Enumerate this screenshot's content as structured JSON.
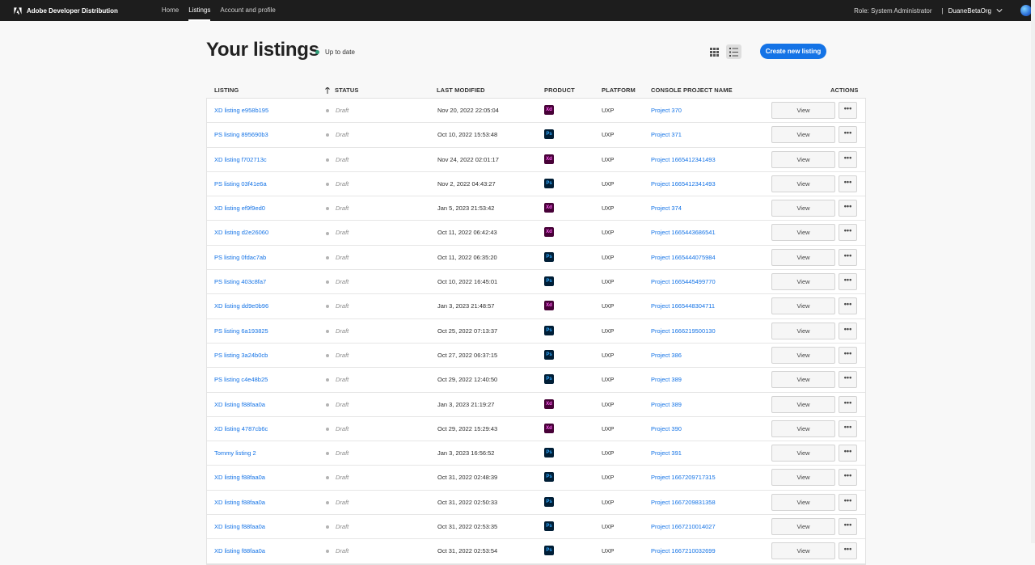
{
  "topbar": {
    "brand": "Adobe Developer Distribution",
    "nav": [
      {
        "label": "Home",
        "active": false
      },
      {
        "label": "Listings",
        "active": true
      },
      {
        "label": "Account and profile",
        "active": false
      }
    ],
    "role": "Role: System Administrator",
    "separator": "|",
    "org": "DuaneBetaOrg"
  },
  "header": {
    "title": "Your listings",
    "status": "Up to date",
    "create_button": "Create new listing"
  },
  "table": {
    "columns": {
      "listing": "LISTING",
      "status": "STATUS",
      "last_modified": "LAST MODIFIED",
      "product": "PRODUCT",
      "platform": "PLATFORM",
      "project": "CONSOLE PROJECT NAME",
      "actions": "ACTIONS"
    },
    "view_label": "View",
    "more_label": "•••",
    "rows": [
      {
        "listing": "XD listing e958b195",
        "status": "Draft",
        "modified": "Nov 20, 2022 22:05:04",
        "product": "Xd",
        "platform": "UXP",
        "project": "Project 370"
      },
      {
        "listing": "PS listing 895690b3",
        "status": "Draft",
        "modified": "Oct 10, 2022 15:53:48",
        "product": "Ps",
        "platform": "UXP",
        "project": "Project 371"
      },
      {
        "listing": "XD listing f702713c",
        "status": "Draft",
        "modified": "Nov 24, 2022 02:01:17",
        "product": "Xd",
        "platform": "UXP",
        "project": "Project 1665412341493"
      },
      {
        "listing": "PS listing 03f41e6a",
        "status": "Draft",
        "modified": "Nov 2, 2022 04:43:27",
        "product": "Ps",
        "platform": "UXP",
        "project": "Project 1665412341493"
      },
      {
        "listing": "XD listing ef9f9ed0",
        "status": "Draft",
        "modified": "Jan 5, 2023 21:53:42",
        "product": "Xd",
        "platform": "UXP",
        "project": "Project 374"
      },
      {
        "listing": "XD listing d2e26060",
        "status": "Draft",
        "modified": "Oct 11, 2022 06:42:43",
        "product": "Xd",
        "platform": "UXP",
        "project": "Project 1665443686541"
      },
      {
        "listing": "PS listing 0fdac7ab",
        "status": "Draft",
        "modified": "Oct 11, 2022 06:35:20",
        "product": "Ps",
        "platform": "UXP",
        "project": "Project 1665444075984"
      },
      {
        "listing": "PS listing 403c8fa7",
        "status": "Draft",
        "modified": "Oct 10, 2022 16:45:01",
        "product": "Ps",
        "platform": "UXP",
        "project": "Project 1665445499770"
      },
      {
        "listing": "XD listing dd9e0b96",
        "status": "Draft",
        "modified": "Jan 3, 2023 21:48:57",
        "product": "Xd",
        "platform": "UXP",
        "project": "Project 1665448304711"
      },
      {
        "listing": "PS listing 6a193825",
        "status": "Draft",
        "modified": "Oct 25, 2022 07:13:37",
        "product": "Ps",
        "platform": "UXP",
        "project": "Project 1666219500130"
      },
      {
        "listing": "PS listing 3a24b0cb",
        "status": "Draft",
        "modified": "Oct 27, 2022 06:37:15",
        "product": "Ps",
        "platform": "UXP",
        "project": "Project 386"
      },
      {
        "listing": "PS listing c4e48b25",
        "status": "Draft",
        "modified": "Oct 29, 2022 12:40:50",
        "product": "Ps",
        "platform": "UXP",
        "project": "Project 389"
      },
      {
        "listing": "XD listing f88faa0a",
        "status": "Draft",
        "modified": "Jan 3, 2023 21:19:27",
        "product": "Xd",
        "platform": "UXP",
        "project": "Project 389"
      },
      {
        "listing": "XD listing 4787cb6c",
        "status": "Draft",
        "modified": "Oct 29, 2022 15:29:43",
        "product": "Xd",
        "platform": "UXP",
        "project": "Project 390"
      },
      {
        "listing": "Tommy listing 2",
        "status": "Draft",
        "modified": "Jan 3, 2023 16:56:52",
        "product": "Ps",
        "platform": "UXP",
        "project": "Project 391"
      },
      {
        "listing": "XD listing f88faa0a",
        "status": "Draft",
        "modified": "Oct 31, 2022 02:48:39",
        "product": "Ps",
        "platform": "UXP",
        "project": "Project 1667209717315"
      },
      {
        "listing": "XD listing f88faa0a",
        "status": "Draft",
        "modified": "Oct 31, 2022 02:50:33",
        "product": "Ps",
        "platform": "UXP",
        "project": "Project 1667209831358"
      },
      {
        "listing": "XD listing f88faa0a",
        "status": "Draft",
        "modified": "Oct 31, 2022 02:53:35",
        "product": "Ps",
        "platform": "UXP",
        "project": "Project 1667210014027"
      },
      {
        "listing": "XD listing f88faa0a",
        "status": "Draft",
        "modified": "Oct 31, 2022 02:53:54",
        "product": "Ps",
        "platform": "UXP",
        "project": "Project 1667210032699"
      }
    ]
  },
  "colors": {
    "accent": "#1473e6",
    "topbar": "#1d1d1d",
    "up_to_date": "#2d9d78"
  }
}
